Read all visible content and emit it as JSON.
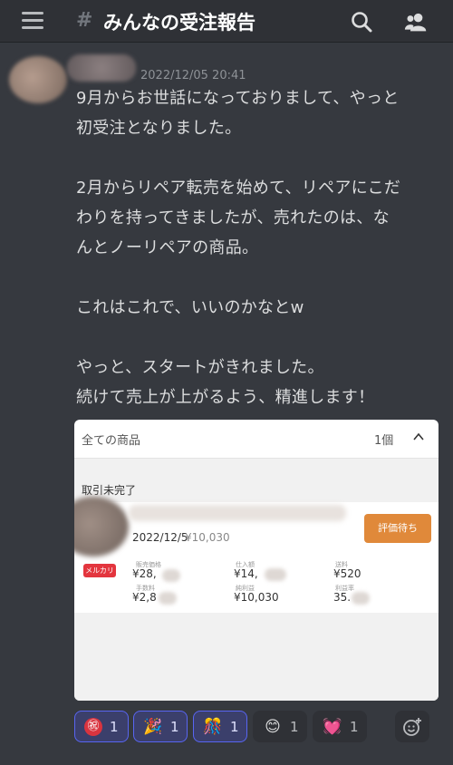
{
  "header": {
    "channel_name": "みんなの受注報告",
    "hash": "#"
  },
  "message": {
    "timestamp": "2022/12/05 20:41",
    "lines": [
      "9月からお世話になっておりまして、やっと",
      "初受注となりました。",
      "",
      "2月からリペア転売を始めて、リペアにこだ",
      "わりを持ってきましたが、売れたのは、な",
      "んとノーリペアの商品。",
      "",
      "これはこれで、いいのかなとw",
      "",
      "やっと、スタートがきれました。",
      "続けて売上が上がるよう、精進します！"
    ]
  },
  "card": {
    "title": "全ての商品",
    "count": "1個",
    "pending_label": "取引未完了",
    "order_date": "2022/12/5",
    "order_amount": "¥10,030",
    "eval_button": "評価待ち",
    "platform_badge": "メルカリ",
    "stats": {
      "sale_price_label": "販売価格",
      "sale_price_value": "¥28,",
      "purchase_label": "仕入額",
      "purchase_value": "¥14,",
      "shipping_label": "送料",
      "shipping_value": "¥520",
      "fee_label": "手数料",
      "fee_value": "¥2,8",
      "profit_label": "純利益",
      "profit_value": "¥10,030",
      "margin_label": "利益率",
      "margin_value": "35."
    }
  },
  "reactions": [
    {
      "emoji": "㊗",
      "count": "1",
      "active": true,
      "icon": "celebration-kanji-icon"
    },
    {
      "emoji": "🎉",
      "count": "1",
      "active": true,
      "icon": "party-popper-icon"
    },
    {
      "emoji": "🎊",
      "count": "1",
      "active": true,
      "icon": "confetti-ball-icon"
    },
    {
      "emoji": "😊",
      "count": "1",
      "active": false,
      "icon": "smiling-face-icon"
    },
    {
      "emoji": "💓",
      "count": "1",
      "active": false,
      "icon": "beating-heart-icon"
    }
  ]
}
